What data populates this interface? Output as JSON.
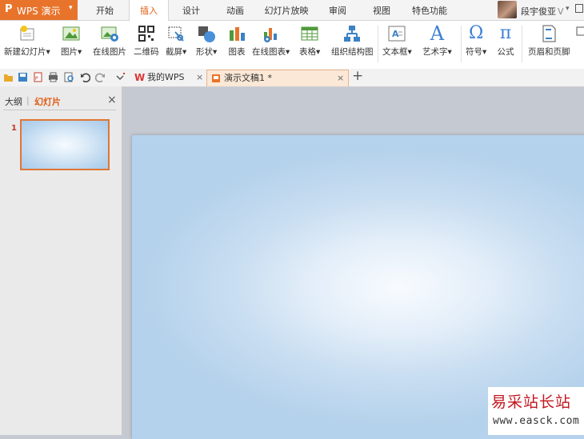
{
  "app": {
    "logo": "P",
    "name": "WPS 演示",
    "menu_arrow": "▾"
  },
  "tabs": [
    "开始",
    "插入",
    "设计",
    "动画",
    "幻灯片放映",
    "审阅",
    "视图",
    "特色功能"
  ],
  "active_tab": "插入",
  "user": {
    "name": "段宇俊亚",
    "badge": "V",
    "caret": "▾"
  },
  "ribbon": {
    "new_slide": "新建幻灯片",
    "picture": "图片",
    "online_picture": "在线图片",
    "qrcode": "二维码",
    "screenshot": "截屏",
    "shapes": "形状",
    "chart": "图表",
    "online_chart": "在线图表",
    "table": "表格",
    "org_chart": "组织结构图",
    "textbox": "文本框",
    "wordart": "艺术字",
    "symbol": "符号",
    "formula": "公式",
    "header_footer": "页眉和页脚",
    "dropdown_marker": "▾",
    "symbol_glyph": "Ω",
    "formula_glyph": "π",
    "wordart_glyph": "A"
  },
  "doc_tabs": [
    {
      "label": "我的WPS",
      "close": "×"
    },
    {
      "label": "演示文稿1 *",
      "close": "×"
    }
  ],
  "new_tab": "+",
  "panel": {
    "outline_tab": "大纲",
    "divider": "|",
    "slides_tab": "幻灯片",
    "close": "×"
  },
  "slides": [
    {
      "number": "1"
    }
  ],
  "watermark": {
    "text": "易采站长站",
    "url": "www.easck.com"
  },
  "colors": {
    "accent": "#e8742c",
    "slide_bg": "#b5d2ec",
    "active_tab_text": "#e05a10"
  }
}
